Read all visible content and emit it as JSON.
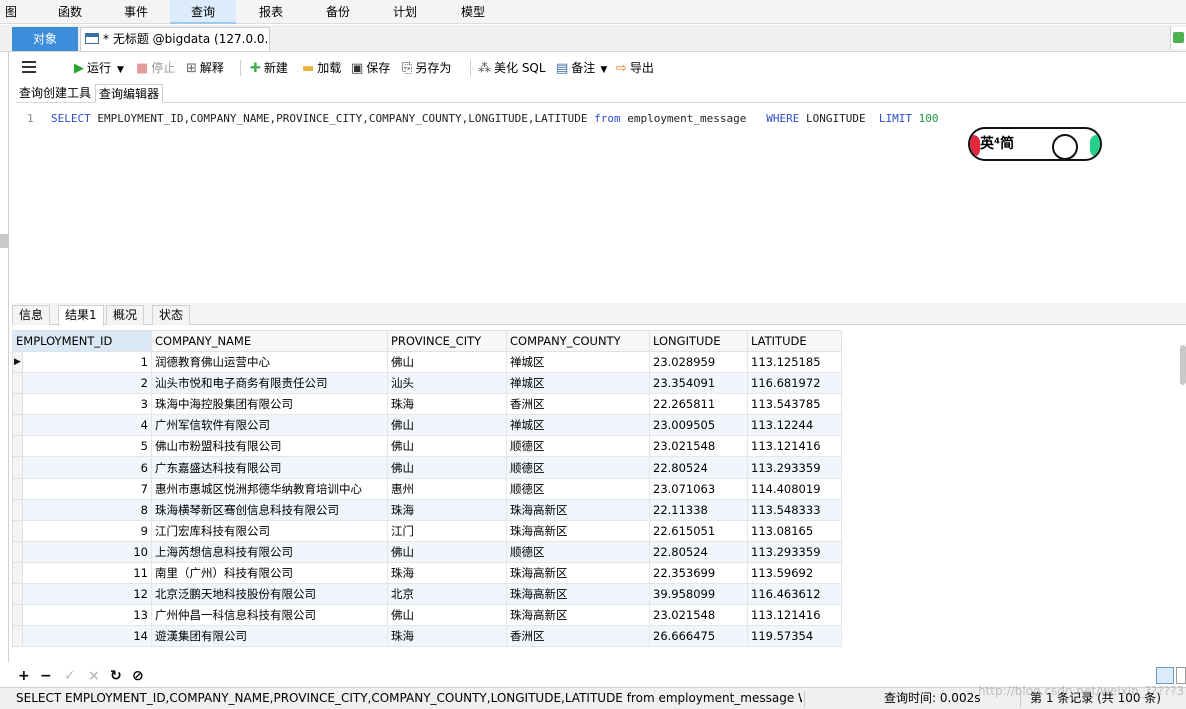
{
  "menu": {
    "items": [
      {
        "label": "图"
      },
      {
        "label": "函数"
      },
      {
        "label": "事件"
      },
      {
        "label": "查询"
      },
      {
        "label": "报表"
      },
      {
        "label": "备份"
      },
      {
        "label": "计划"
      },
      {
        "label": "模型"
      }
    ],
    "active": "查询"
  },
  "tabs": {
    "objects": "对象",
    "query_tab": "* 无标题 @bigdata (127.0.0...."
  },
  "toolbar": {
    "run": "运行",
    "stop": "停止",
    "explain": "解释",
    "new": "新建",
    "load": "加载",
    "save": "保存",
    "save_as": "另存为",
    "beautify": "美化 SQL",
    "notes": "备注",
    "export": "导出"
  },
  "subtabs": {
    "builder": "查询创建工具",
    "editor": "查询编辑器"
  },
  "editor": {
    "line_number": "1",
    "kw_select": "SELECT",
    "columns": " EMPLOYMENT_ID,COMPANY_NAME,PROVINCE_CITY,COMPANY_COUNTY,LONGITUDE,LATITUDE ",
    "kw_from": "from",
    "table": " employment_message   ",
    "kw_where": "WHERE",
    "where_col": " LONGITUDE  ",
    "kw_limit": "LIMIT",
    "limit_val": " 100"
  },
  "sticker": {
    "text": "英⁴简"
  },
  "result_tabs": {
    "info": "信息",
    "result1": "结果1",
    "profile": "概况",
    "status": "状态"
  },
  "grid": {
    "headers": [
      "EMPLOYMENT_ID",
      "COMPANY_NAME",
      "PROVINCE_CITY",
      "COMPANY_COUNTY",
      "LONGITUDE",
      "LATITUDE"
    ],
    "rows": [
      [
        "1",
        "润德教育佛山运营中心",
        "佛山",
        "禅城区",
        "23.028959",
        "113.125185"
      ],
      [
        "2",
        "汕头市悦和电子商务有限责任公司",
        "汕头",
        "禅城区",
        "23.354091",
        "116.681972"
      ],
      [
        "3",
        "珠海中海控股集团有限公司",
        "珠海",
        "香洲区",
        "22.265811",
        "113.543785"
      ],
      [
        "4",
        "广州军信软件有限公司",
        "佛山",
        "禅城区",
        "23.009505",
        "113.12244"
      ],
      [
        "5",
        "佛山市粉盟科技有限公司",
        "佛山",
        "顺德区",
        "23.021548",
        "113.121416"
      ],
      [
        "6",
        "广东嘉盛达科技有限公司",
        "佛山",
        "顺德区",
        "22.80524",
        "113.293359"
      ],
      [
        "7",
        "惠州市惠城区悦洲邦德华纳教育培训中心",
        "惠州",
        "顺德区",
        "23.071063",
        "114.408019"
      ],
      [
        "8",
        "珠海横琴新区骞创信息科技有限公司",
        "珠海",
        "珠海高新区",
        "22.11338",
        "113.548333"
      ],
      [
        "9",
        "江门宏库科技有限公司",
        "江门",
        "珠海高新区",
        "22.615051",
        "113.08165"
      ],
      [
        "10",
        "上海芮想信息科技有限公司",
        "佛山",
        "顺德区",
        "22.80524",
        "113.293359"
      ],
      [
        "11",
        "南里（广州）科技有限公司",
        "珠海",
        "珠海高新区",
        "22.353699",
        "113.59692"
      ],
      [
        "12",
        "北京泛鹏天地科技股份有限公司",
        "北京",
        "珠海高新区",
        "39.958099",
        "116.463612"
      ],
      [
        "13",
        "广州仲昌一科信息科技有限公司",
        "佛山",
        "珠海高新区",
        "23.021548",
        "113.121416"
      ],
      [
        "14",
        "遊漢集团有限公司",
        "珠海",
        "香洲区",
        "26.666475",
        "119.57354"
      ]
    ]
  },
  "status": {
    "sql": "SELECT EMPLOYMENT_ID,COMPANY_NAME,PROVINCE_CITY,COMPANY_COUNTY,LONGITUDE,LATITUDE from employment_message   WHEF",
    "query_time": "查询时间: 0.002s",
    "records": "第 1 条记录 (共 100 条)",
    "watermark": "http://blog.csdn.net/weixin_?????3"
  },
  "colors": {
    "accent": "#3c8edb",
    "keyword": "#2b4fcf",
    "number": "#1a9a3a",
    "run_green": "#2aa52a"
  }
}
